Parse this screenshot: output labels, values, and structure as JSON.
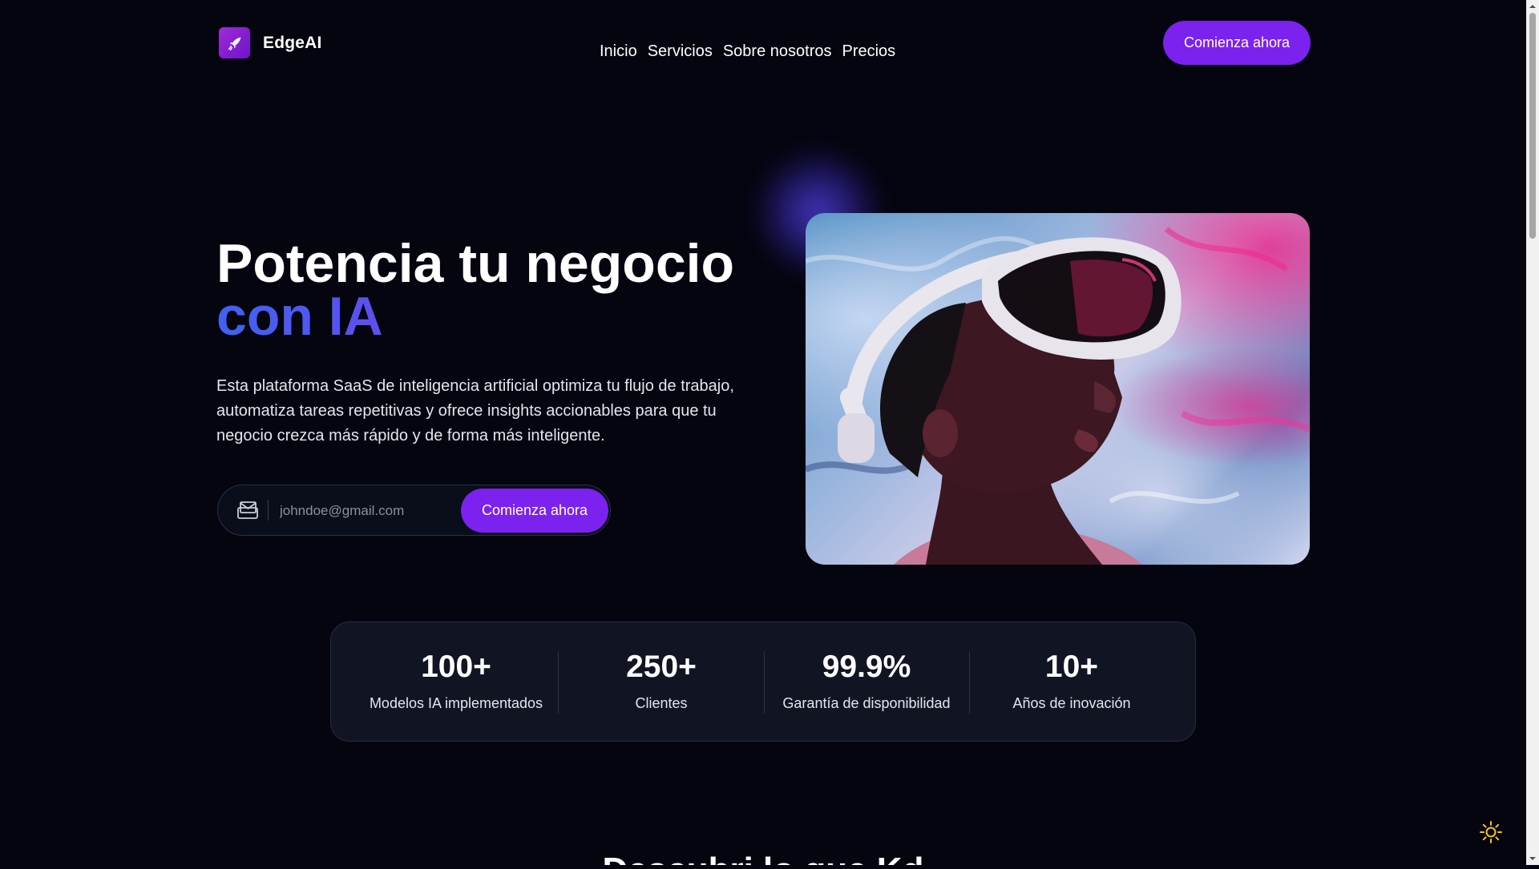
{
  "brand": {
    "name": "EdgeAI",
    "logo_icon": "rocket-icon",
    "accent": "#7b22ee"
  },
  "nav": {
    "items": [
      "Inicio",
      "Servicios",
      "Sobre nosotros",
      "Precios"
    ]
  },
  "header": {
    "cta_label": "Comienza ahora"
  },
  "hero": {
    "title_line1": "Potencia tu negocio",
    "title_line2": "con IA",
    "description": "Esta plataforma SaaS de inteligencia artificial optimiza tu flujo de trabajo, automatiza tareas repetitivas y ofrece insights accionables para que tu negocio crezca más rápido y de forma más inteligente.",
    "email_placeholder": "johndoe@gmail.com",
    "form_cta_label": "Comienza ahora",
    "mail_icon": "mail-icon"
  },
  "stats": [
    {
      "value": "100+",
      "label": "Modelos IA implementados"
    },
    {
      "value": "250+",
      "label": "Clientes"
    },
    {
      "value": "99.9%",
      "label": "Garantía de disponibilidad"
    },
    {
      "value": "10+",
      "label": "Años de inovación"
    }
  ],
  "next_section": {
    "heading": "Descubri lo que Kd"
  },
  "theme_toggle": {
    "icon": "sun-icon",
    "color": "#f5c518"
  }
}
